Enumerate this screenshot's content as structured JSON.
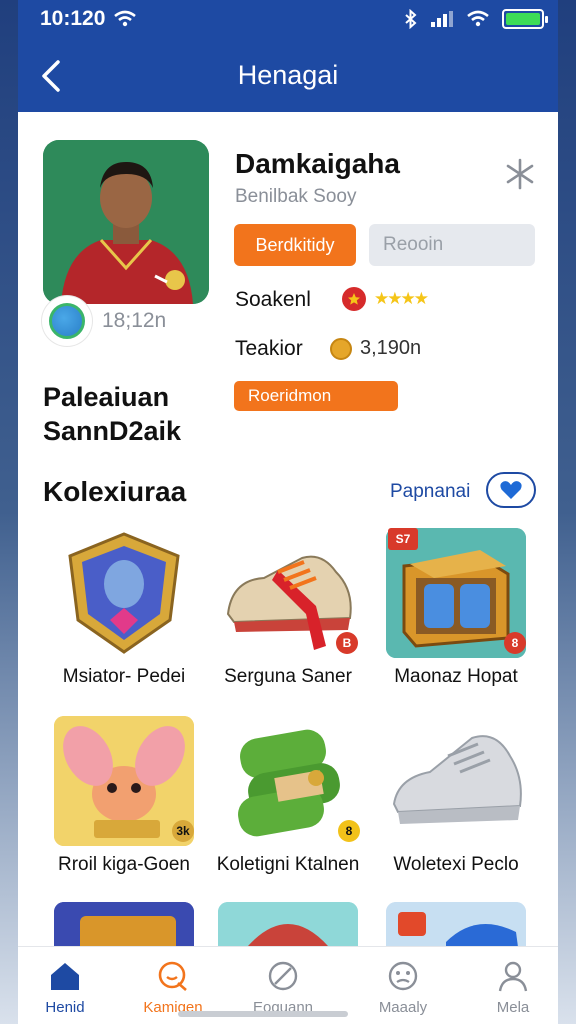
{
  "status_bar": {
    "time": "10:120"
  },
  "header": {
    "title": "Henagai",
    "back_icon": "chevron-left-icon"
  },
  "profile": {
    "name": "Damkaigaha",
    "subtitle": "Benilbak Sooy",
    "online_time": "18;12n",
    "primary_button": "Berdkitidy",
    "secondary_button": "Reooin",
    "stat1_label": "Soakenl",
    "stat1_stars": "★★★★",
    "stat2_label": "Teakior",
    "stat2_value": "3,190n",
    "rank_button": "Roeridmon",
    "player_name_line1": "Paleaiuan",
    "player_name_line2": "SannD2aik"
  },
  "collection": {
    "title": "Kolexiuraa",
    "see_all": "Papnanai",
    "items": [
      {
        "label": "Msiator- Pedei",
        "badge": ""
      },
      {
        "label": "Serguna Saner",
        "badge": "B"
      },
      {
        "label": "Maonaz Hopat",
        "badge": "8",
        "tag": "S7"
      },
      {
        "label": "Rroil kiga-Goen",
        "badge": "3k"
      },
      {
        "label": "Koletigni Ktalnen",
        "badge": "8"
      },
      {
        "label": "Woletexi Peclo",
        "badge": ""
      }
    ]
  },
  "tabbar": {
    "tabs": [
      {
        "label": "Henid",
        "icon": "home-icon",
        "color": "#1e4aa3"
      },
      {
        "label": "Kamigen",
        "icon": "chat-icon",
        "color": "#f2741c"
      },
      {
        "label": "Eoguann",
        "icon": "compass-icon",
        "color": "#8a8f98"
      },
      {
        "label": "Maaaly",
        "icon": "face-icon",
        "color": "#8a8f98"
      },
      {
        "label": "Mela",
        "icon": "profile-icon",
        "color": "#8a8f98"
      }
    ]
  },
  "colors": {
    "header": "#1e4aa3",
    "accent": "#f2741c"
  }
}
